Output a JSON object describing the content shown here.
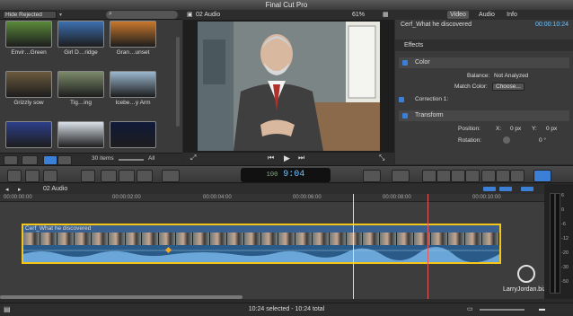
{
  "app": {
    "title": "Final Cut Pro"
  },
  "browser": {
    "filter": "Hide Rejected",
    "clips": [
      {
        "name": "Envir…Green",
        "color": "#5a8a3a"
      },
      {
        "name": "Girl D…ridge",
        "color": "#3c6fb0"
      },
      {
        "name": "Gran…unset",
        "color": "#c9772d"
      },
      {
        "name": "Grizzly sow",
        "color": "#6b5a3e"
      },
      {
        "name": "Tig…ing",
        "color": "#7c8a6a"
      },
      {
        "name": "Icebe…y Arm",
        "color": "#9bb8cf"
      },
      {
        "name": "",
        "color": "#2d3f8a"
      },
      {
        "name": "",
        "color": "#d9e0e8"
      },
      {
        "name": "",
        "color": "#101a3a"
      }
    ],
    "item_count": "30 items",
    "all_label": "All"
  },
  "viewer": {
    "clip_name": "02 Audio",
    "zoom": "61%"
  },
  "inspector": {
    "tabs": [
      "Video",
      "Audio",
      "Info"
    ],
    "clip_title": "Cerf_What he discovered",
    "timecode": "00:00:10:24",
    "effects_label": "Effects",
    "color": {
      "label": "Color",
      "balance_label": "Balance:",
      "balance_value": "Not Analyzed",
      "match_label": "Match Color:",
      "choose_label": "Choose...",
      "correction_label": "Correction 1:"
    },
    "transform": {
      "label": "Transform",
      "position_label": "Position:",
      "x_label": "X:",
      "x_value": "0 px",
      "y_label": "Y:",
      "y_value": "0 px",
      "rotation_label": "Rotation:",
      "rotation_value": "0 °"
    }
  },
  "toolbar": {
    "timecode": "9:04",
    "tc_prefix": "100"
  },
  "timeline": {
    "project_name": "02 Audio",
    "ruler_marks": [
      "00:00:00:00",
      "00:00:02:00",
      "00:00:04:00",
      "00:00:06:00",
      "00:00:08:00",
      "00:00:10:00"
    ],
    "clip_label": "Cerf_What he discovered",
    "meter_labels": [
      "6",
      "0",
      "-6",
      "-12",
      "-20",
      "-30",
      "-50"
    ]
  },
  "status": {
    "selection": "10:24 selected - 10:24 total"
  },
  "watermark": "LarryJordan.biz",
  "colors": {
    "selection_yellow": "#f5c518",
    "audio_blue": "#2f5f8f",
    "accent_blue": "#3b7fd6",
    "playhead_red": "#e85a5a"
  }
}
